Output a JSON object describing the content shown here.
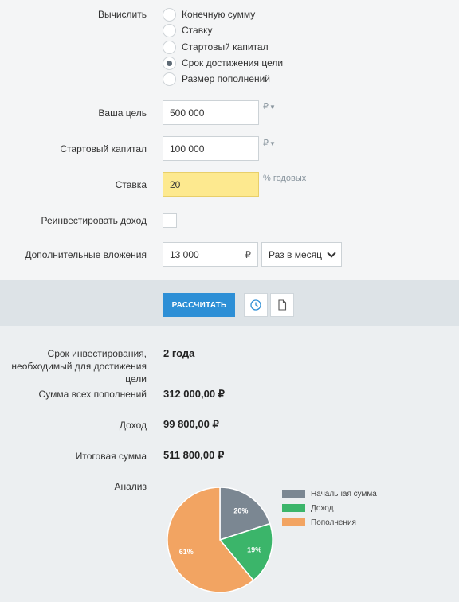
{
  "form": {
    "calculate_label": "Вычислить",
    "options": [
      {
        "label": "Конечную сумму",
        "checked": false
      },
      {
        "label": "Ставку",
        "checked": false
      },
      {
        "label": "Стартовый капитал",
        "checked": false
      },
      {
        "label": "Срок достижения цели",
        "checked": true
      },
      {
        "label": "Размер пополнений",
        "checked": false
      }
    ],
    "goal_label": "Ваша цель",
    "goal_value": "500 000",
    "goal_unit": "₽",
    "start_label": "Стартовый капитал",
    "start_value": "100 000",
    "start_unit": "₽",
    "rate_label": "Ставка",
    "rate_value": "20",
    "rate_unit": "% годовых",
    "reinvest_label": "Реинвестировать доход",
    "reinvest_checked": false,
    "extra_label": "Дополнительные вложения",
    "extra_value": "13 000",
    "extra_unit": "₽",
    "frequency_value": "Раз в месяц"
  },
  "actions": {
    "calculate_button": "РАССЧИТАТЬ",
    "history_icon": "clock-icon",
    "document_icon": "document-icon"
  },
  "results": {
    "term_label_line1": "Срок инвестирования,",
    "term_label_line2": "необходимый для достижения цели",
    "term_value": "2 года",
    "deposits_label": "Сумма всех пополнений",
    "deposits_value": "312 000,00 ₽",
    "income_label": "Доход",
    "income_value": "99 800,00 ₽",
    "total_label": "Итоговая сумма",
    "total_value": "511 800,00 ₽",
    "analysis_label": "Анализ"
  },
  "chart_data": {
    "type": "pie",
    "slices": [
      {
        "name": "Начальная сумма",
        "percent": 20,
        "label": "20%",
        "color": "#7b8792"
      },
      {
        "name": "Доход",
        "percent": 19,
        "label": "19%",
        "color": "#3bb56a"
      },
      {
        "name": "Пополнения",
        "percent": 61,
        "label": "61%",
        "color": "#f2a462"
      }
    ],
    "legend": "right"
  }
}
